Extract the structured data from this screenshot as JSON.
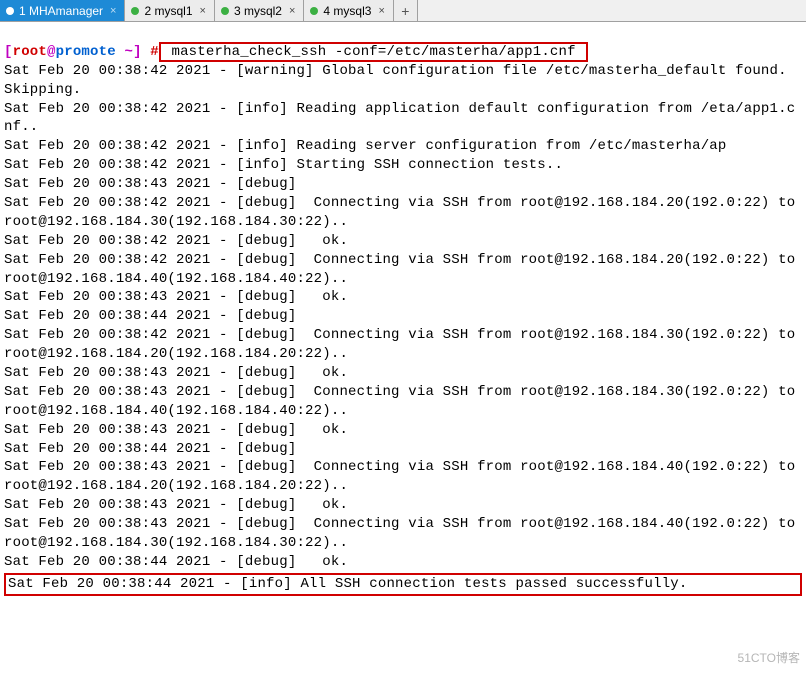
{
  "tabs": [
    {
      "label": "1 MHAmanager",
      "active": true
    },
    {
      "label": "2 mysql1",
      "active": false
    },
    {
      "label": "3 mysql2",
      "active": false
    },
    {
      "label": "4 mysql3",
      "active": false
    }
  ],
  "tab_add_glyph": "+",
  "tab_close_glyph": "×",
  "prompt": {
    "open": "[",
    "user": "root",
    "at": "@",
    "host": "promote",
    "space": " ",
    "tilde": "~",
    "close": "]",
    "hash": " #"
  },
  "command": " masterha_check_ssh -conf=/etc/masterha/app1.cnf ",
  "log_lines": [
    "Sat Feb 20 00:38:42 2021 - [warning] Global configuration file /etc/masterha_default found. Skipping.",
    "Sat Feb 20 00:38:42 2021 - [info] Reading application default configuration from /eta/app1.cnf..",
    "Sat Feb 20 00:38:42 2021 - [info] Reading server configuration from /etc/masterha/ap",
    "Sat Feb 20 00:38:42 2021 - [info] Starting SSH connection tests..",
    "Sat Feb 20 00:38:43 2021 - [debug]",
    "Sat Feb 20 00:38:42 2021 - [debug]  Connecting via SSH from root@192.168.184.20(192.0:22) to root@192.168.184.30(192.168.184.30:22)..",
    "Sat Feb 20 00:38:42 2021 - [debug]   ok.",
    "Sat Feb 20 00:38:42 2021 - [debug]  Connecting via SSH from root@192.168.184.20(192.0:22) to root@192.168.184.40(192.168.184.40:22)..",
    "Sat Feb 20 00:38:43 2021 - [debug]   ok.",
    "Sat Feb 20 00:38:44 2021 - [debug]",
    "Sat Feb 20 00:38:42 2021 - [debug]  Connecting via SSH from root@192.168.184.30(192.0:22) to root@192.168.184.20(192.168.184.20:22)..",
    "Sat Feb 20 00:38:43 2021 - [debug]   ok.",
    "Sat Feb 20 00:38:43 2021 - [debug]  Connecting via SSH from root@192.168.184.30(192.0:22) to root@192.168.184.40(192.168.184.40:22)..",
    "Sat Feb 20 00:38:43 2021 - [debug]   ok.",
    "Sat Feb 20 00:38:44 2021 - [debug]",
    "Sat Feb 20 00:38:43 2021 - [debug]  Connecting via SSH from root@192.168.184.40(192.0:22) to root@192.168.184.20(192.168.184.20:22)..",
    "Sat Feb 20 00:38:43 2021 - [debug]   ok.",
    "Sat Feb 20 00:38:43 2021 - [debug]  Connecting via SSH from root@192.168.184.40(192.0:22) to root@192.168.184.30(192.168.184.30:22)..",
    "Sat Feb 20 00:38:44 2021 - [debug]   ok."
  ],
  "result_line": "Sat Feb 20 00:38:44 2021 - [info] All SSH connection tests passed successfully.",
  "watermark": "51CTO博客"
}
